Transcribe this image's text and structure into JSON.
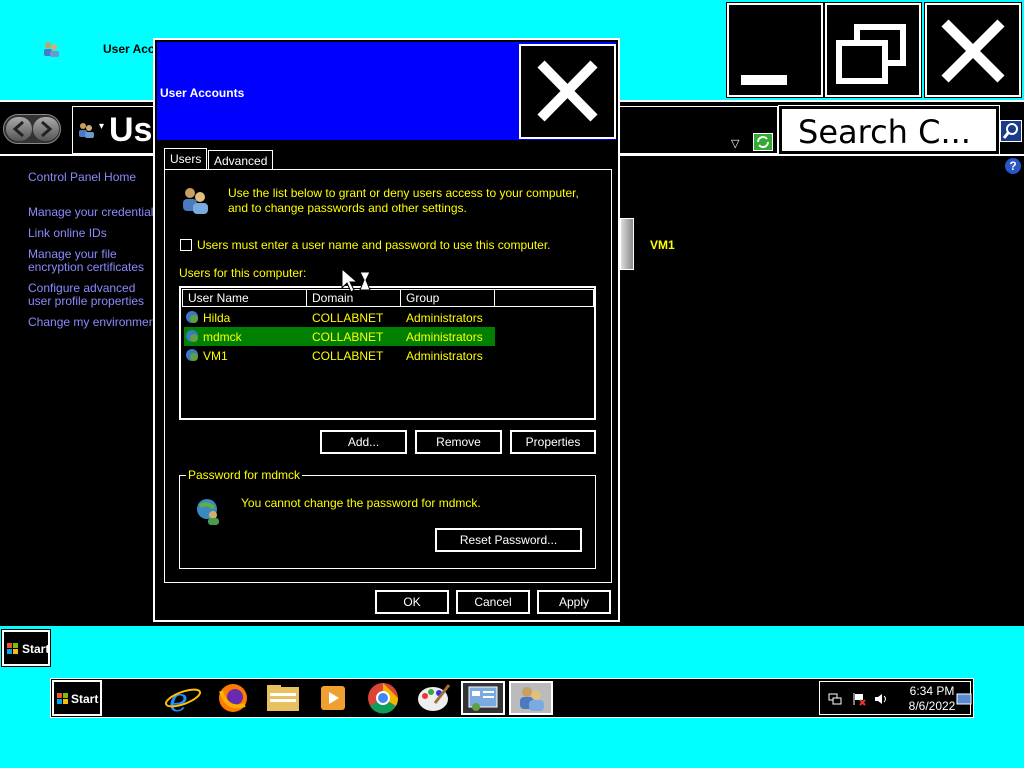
{
  "window": {
    "title": "User Accounts",
    "breadcrumb": "Use",
    "search_text": "Search C..."
  },
  "left_nav": {
    "home": "Control Panel Home",
    "manage_credentials": "Manage your credentials",
    "link_online": "Link online IDs",
    "file_encryption": "Manage your file encryption certificates",
    "advanced_profile": "Configure advanced user profile properties",
    "env_vars": "Change my environment variables"
  },
  "background": {
    "vm1_label": "VM1",
    "help_glyph": "?"
  },
  "dialog": {
    "title": "User Accounts",
    "tabs": [
      "Users",
      "Advanced"
    ],
    "info_text": "Use the list below to grant or deny users access to your computer, and to change passwords and other settings.",
    "checkbox_label": "Users must enter a user name and password to use this computer.",
    "checkbox_checked": false,
    "users_label": "Users for this computer:",
    "columns": [
      "User Name",
      "Domain",
      "Group"
    ],
    "rows": [
      {
        "name": "Hilda",
        "domain": "COLLABNET",
        "group": "Administrators",
        "selected": false
      },
      {
        "name": "mdmck",
        "domain": "COLLABNET",
        "group": "Administrators",
        "selected": true
      },
      {
        "name": "VM1",
        "domain": "COLLABNET",
        "group": "Administrators",
        "selected": false
      }
    ],
    "buttons": {
      "add": "Add...",
      "remove": "Remove",
      "properties": "Properties",
      "reset_password": "Reset Password...",
      "ok": "OK",
      "cancel": "Cancel",
      "apply": "Apply"
    },
    "password_group_label": "Password for mdmck",
    "password_message": "You cannot change the password for mdmck."
  },
  "taskbar": {
    "start_small": "Start",
    "start": "Start",
    "apps": [
      "internet-explorer-icon",
      "firefox-icon",
      "file-explorer-icon",
      "media-player-icon",
      "chrome-icon",
      "paint-icon",
      "control-panel-icon",
      "user-accounts-icon"
    ],
    "time": "6:34 PM",
    "date": "8/6/2022"
  },
  "colors": {
    "background": "#00ffff",
    "dialog_title": "#0000ff",
    "text_yellow": "#ffff00",
    "selection": "#008000",
    "link": "#8a8aff"
  }
}
